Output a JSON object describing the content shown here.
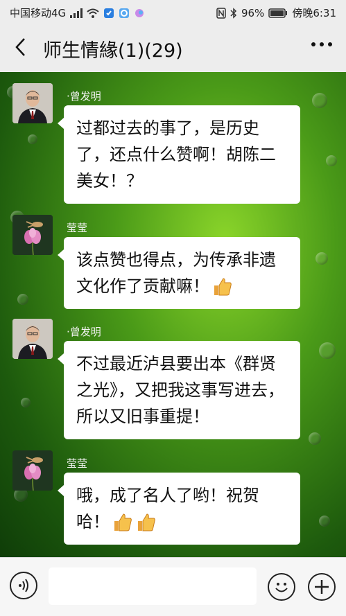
{
  "status_bar": {
    "carrier": "中国移动4G",
    "battery": "96%",
    "time": "傍晚6:31"
  },
  "nav": {
    "title": "师生情緣(1)(29)",
    "back_icon": "chevron-left-icon",
    "more_icon": "more-dots-icon"
  },
  "messages": [
    {
      "sender": "·曾发明",
      "avatar": "man-avatar",
      "text": "过都过去的事了，是历史了，还点什么赞啊！胡陈二美女！？",
      "thumbs": 0
    },
    {
      "sender": "莹莹",
      "avatar": "flower-avatar",
      "text": "该点赞也得点，为传承非遗文化作了贡献嘛！",
      "thumbs": 1
    },
    {
      "sender": "·曾发明",
      "avatar": "man-avatar",
      "text": "不过最近泸县要出本《群贤之光》，又把我这事写进去，所以又旧事重提！",
      "thumbs": 0
    },
    {
      "sender": "莹莹",
      "avatar": "flower-avatar",
      "text": "哦，成了名人了哟！祝贺哈！",
      "thumbs": 2
    }
  ],
  "input_bar": {
    "voice_icon": "voice-icon",
    "emoji_icon": "emoji-icon",
    "plus_icon": "plus-icon"
  },
  "colors": {
    "chat_bg": "#3f8c16",
    "bubble": "#ffffff",
    "bar": "#ededed"
  }
}
